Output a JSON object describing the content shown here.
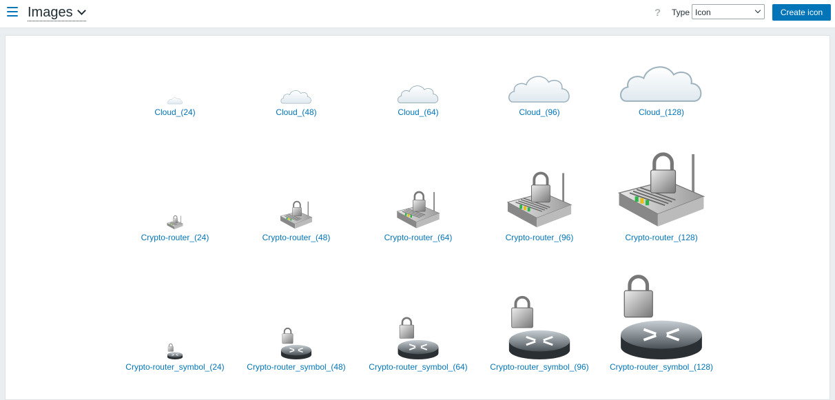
{
  "header": {
    "title": "Images",
    "help": "?",
    "type_label": "Type",
    "type_value": "Icon",
    "create_button": "Create icon"
  },
  "colors": {
    "accent": "#0275b8",
    "background": "#ebeef0"
  },
  "rows": [
    {
      "kind": "cloud",
      "items": [
        {
          "label": "Cloud_(24)",
          "size": 24
        },
        {
          "label": "Cloud_(48)",
          "size": 48
        },
        {
          "label": "Cloud_(64)",
          "size": 64
        },
        {
          "label": "Cloud_(96)",
          "size": 96
        },
        {
          "label": "Cloud_(128)",
          "size": 128
        }
      ]
    },
    {
      "kind": "crypto-router",
      "items": [
        {
          "label": "Crypto-router_(24)",
          "size": 24
        },
        {
          "label": "Crypto-router_(48)",
          "size": 48
        },
        {
          "label": "Crypto-router_(64)",
          "size": 64
        },
        {
          "label": "Crypto-router_(96)",
          "size": 96
        },
        {
          "label": "Crypto-router_(128)",
          "size": 128
        }
      ]
    },
    {
      "kind": "crypto-router-symbol",
      "items": [
        {
          "label": "Crypto-router_symbol_(24)",
          "size": 24
        },
        {
          "label": "Crypto-router_symbol_(48)",
          "size": 48
        },
        {
          "label": "Crypto-router_symbol_(64)",
          "size": 64
        },
        {
          "label": "Crypto-router_symbol_(96)",
          "size": 96
        },
        {
          "label": "Crypto-router_symbol_(128)",
          "size": 128
        }
      ]
    }
  ]
}
